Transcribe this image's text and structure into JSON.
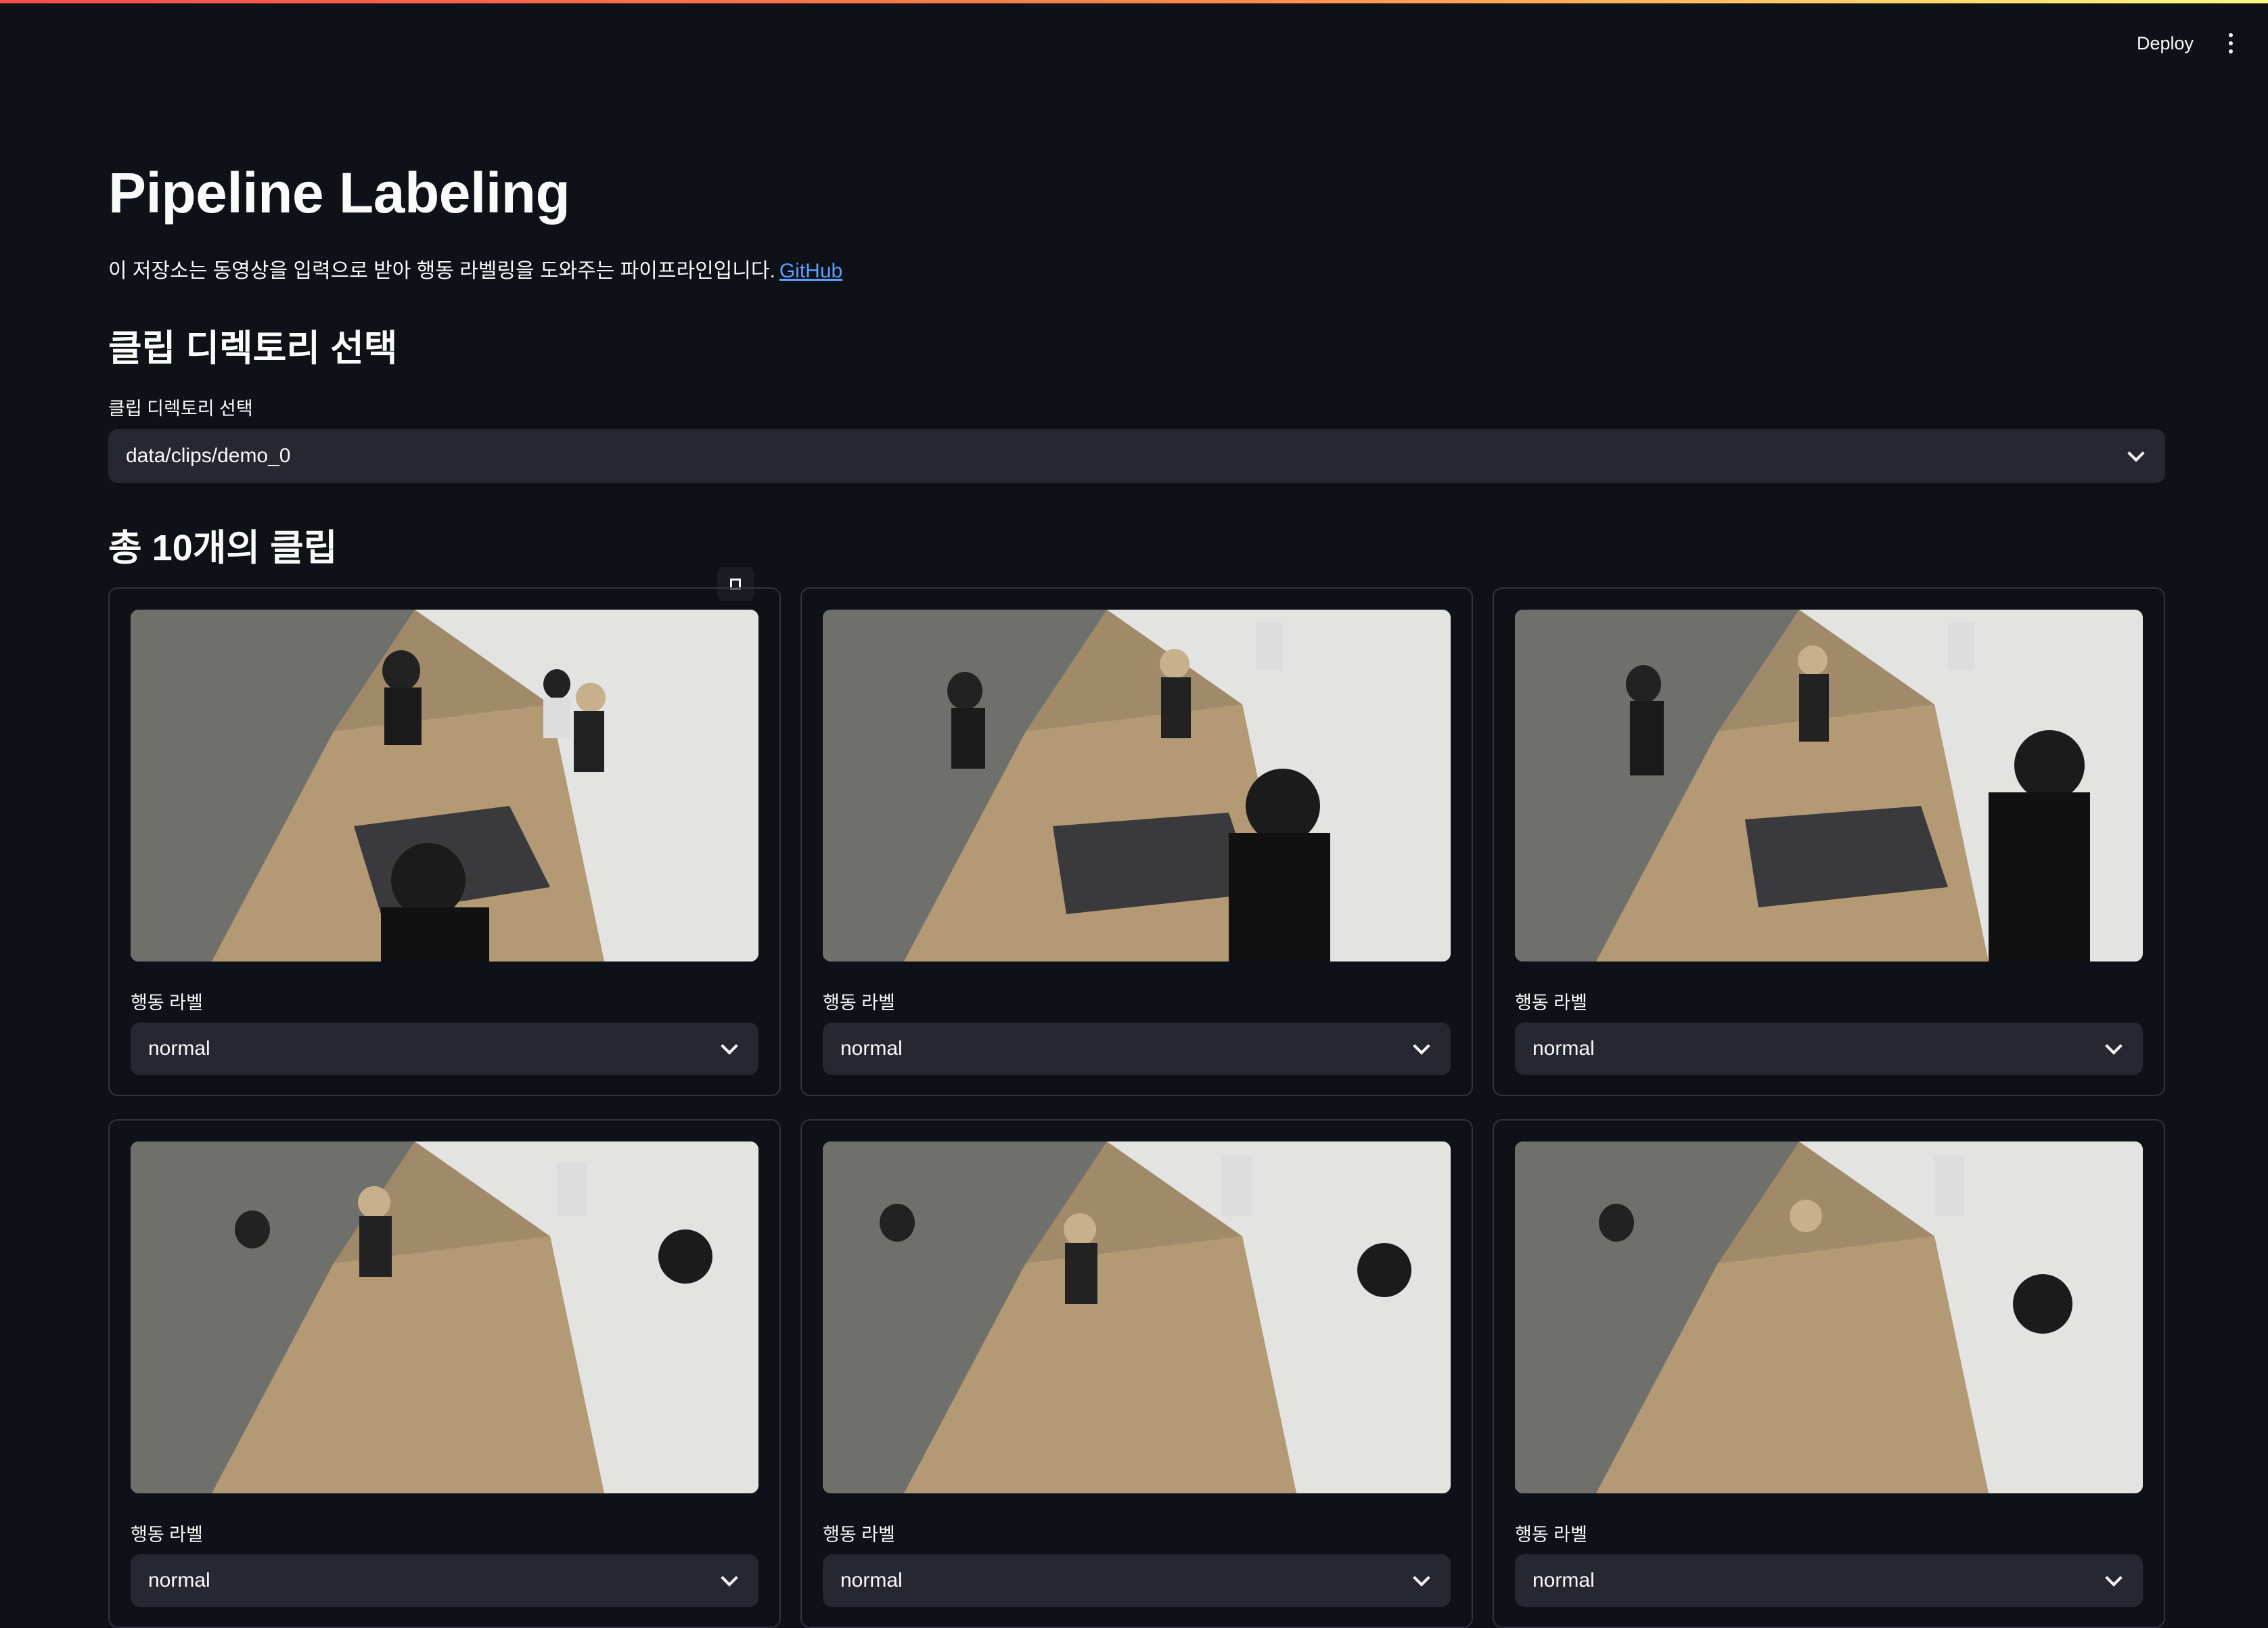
{
  "header": {
    "deploy_label": "Deploy",
    "menu_icon": "more-vertical-icon"
  },
  "page": {
    "title": "Pipeline Labeling",
    "description": "이 저장소는 동영상을 입력으로 받아 행동 라벨링을 도와주는 파이프라인입니다.",
    "link_text": "GitHub"
  },
  "directory_section": {
    "heading": "클립 디렉토리 선택",
    "select_label": "클립 디렉토리 선택",
    "selected_value": "data/clips/demo_0"
  },
  "clips_section": {
    "heading": "총 10개의 클립",
    "clips": [
      {
        "label": "행동 라벨",
        "value": "normal"
      },
      {
        "label": "행동 라벨",
        "value": "normal"
      },
      {
        "label": "행동 라벨",
        "value": "normal"
      },
      {
        "label": "행동 라벨",
        "value": "normal"
      },
      {
        "label": "행동 라벨",
        "value": "normal"
      },
      {
        "label": "행동 라벨",
        "value": "normal"
      }
    ]
  },
  "colors": {
    "background": "#0e1117",
    "input_bg": "#262730",
    "link": "#5aa0ff",
    "border": "#31333f"
  }
}
